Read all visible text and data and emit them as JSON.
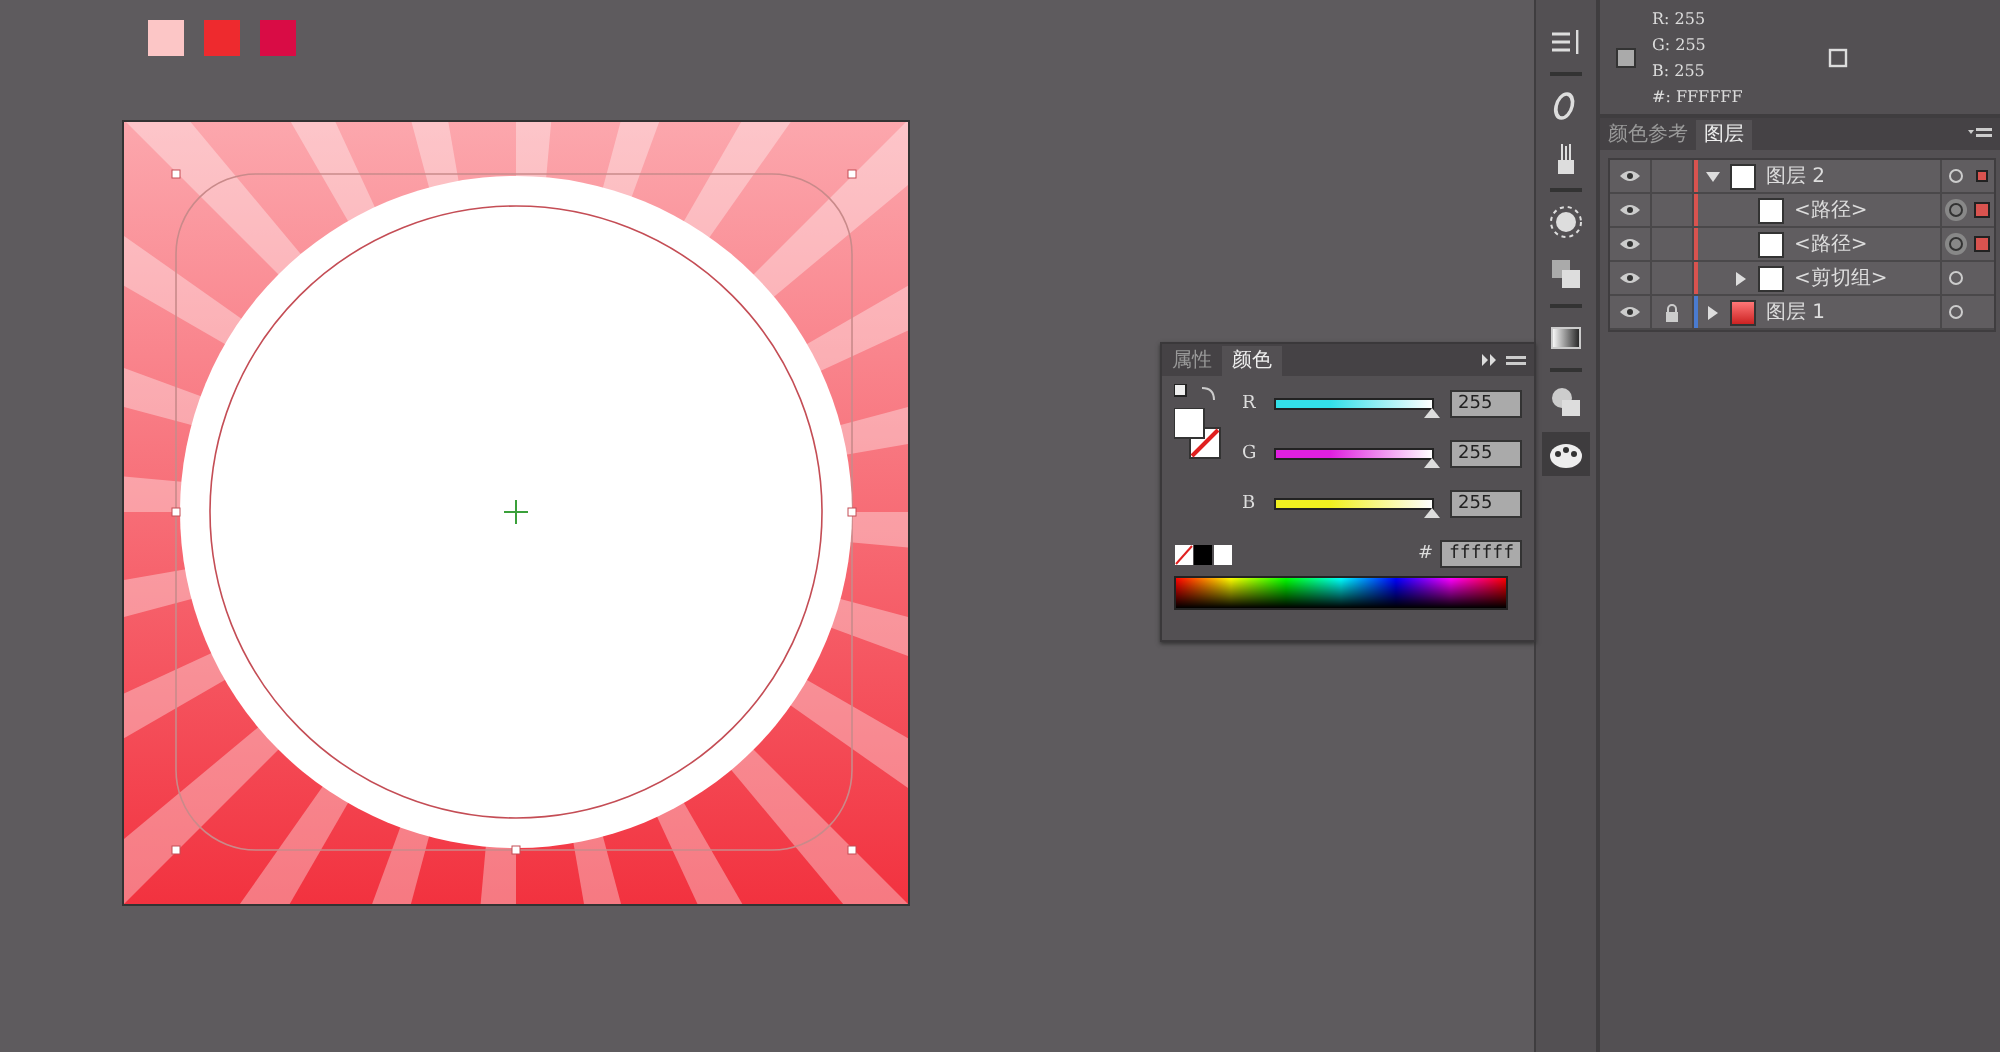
{
  "swatches": [
    {
      "color": "#fcc6c6"
    },
    {
      "color": "#ee2a2e"
    },
    {
      "color": "#d90c45"
    }
  ],
  "info": {
    "r": "R: 255",
    "g": "G: 255",
    "b": "B: 255",
    "hex": "#: FFFFFF"
  },
  "panel_tabs": [
    {
      "label": "颜色参考",
      "selected": false
    },
    {
      "label": "图层",
      "selected": true
    }
  ],
  "layers": [
    {
      "name": "图层 2",
      "visible": true,
      "locked": false,
      "expanded": true,
      "selected": true,
      "color": "#d9534f",
      "children": [
        {
          "name": "<路径>",
          "visible": true,
          "locked": false,
          "selected": true,
          "color": "#d9534f"
        },
        {
          "name": "<路径>",
          "visible": true,
          "locked": false,
          "selected": true,
          "color": "#d9534f"
        },
        {
          "name": "<剪切组>",
          "visible": true,
          "locked": false,
          "expanded": false,
          "selected": false,
          "color": "#d9534f"
        }
      ]
    },
    {
      "name": "图层 1",
      "visible": true,
      "locked": true,
      "expanded": false,
      "selected": false,
      "color": "#4a7bd0"
    }
  ],
  "color_panel": {
    "tabs": [
      {
        "label": "属性",
        "selected": false
      },
      {
        "label": "颜色",
        "selected": true
      }
    ],
    "channels": [
      {
        "label": "R",
        "value": "255",
        "level": 1,
        "color": "#33e0e8"
      },
      {
        "label": "G",
        "value": "255",
        "level": 1,
        "color": "#e020e0"
      },
      {
        "label": "B",
        "value": "255",
        "level": 1,
        "color": "#f0f020"
      }
    ],
    "hex_label": "#",
    "hex": "ffffff"
  }
}
